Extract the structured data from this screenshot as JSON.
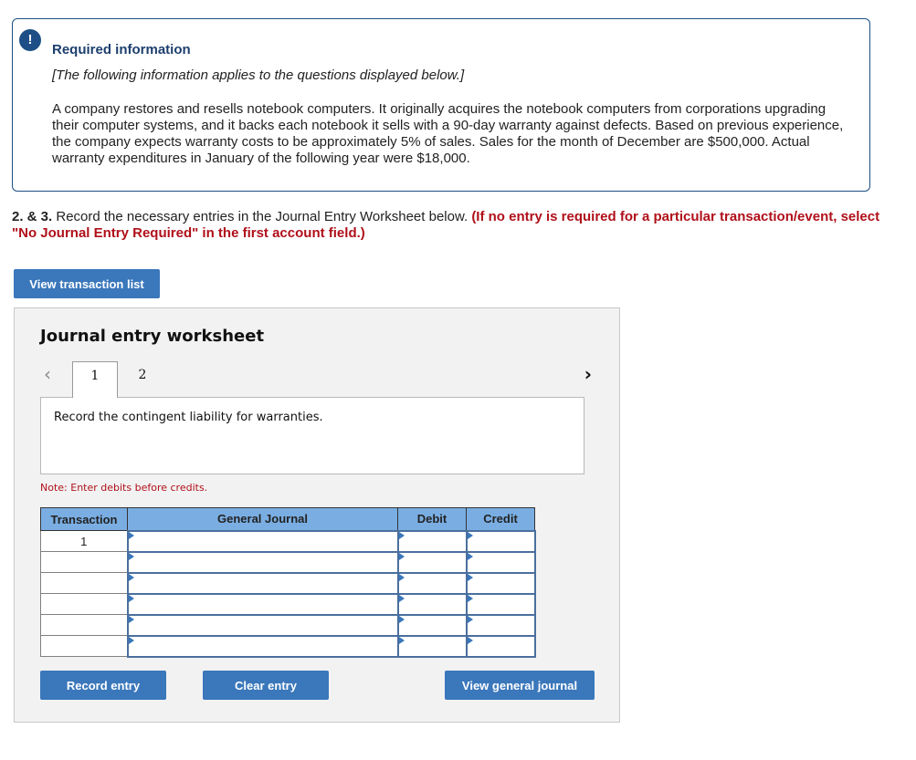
{
  "info": {
    "badge": "!",
    "title": "Required information",
    "subtitle": "[The following information applies to the questions displayed below.]",
    "body": "A company restores and resells notebook computers. It originally acquires the notebook computers from corporations upgrading their computer systems, and it backs each notebook it sells with a 90-day warranty against defects. Based on previous experience, the company expects warranty costs to be approximately 5% of sales. Sales for the month of December are $500,000. Actual warranty expenditures in January of the following year were $18,000."
  },
  "question": {
    "number": "2. & 3.",
    "text": " Record the necessary entries in the Journal Entry Worksheet below. ",
    "instruction": "(If no entry is required for a particular transaction/event, select \"No Journal Entry Required\" in the first account field.)"
  },
  "buttons": {
    "view_transaction_list": "View transaction list",
    "record_entry": "Record entry",
    "clear_entry": "Clear entry",
    "view_general_journal": "View general journal"
  },
  "worksheet": {
    "title": "Journal entry worksheet",
    "prev_icon": "‹",
    "next_icon": "›",
    "tabs": [
      "1",
      "2"
    ],
    "active_tab": "1",
    "description": "Record the contingent liability for warranties.",
    "note": "Note: Enter debits before credits.",
    "table": {
      "headers": [
        "Transaction",
        "General Journal",
        "Debit",
        "Credit"
      ],
      "rows": [
        {
          "transaction": "1",
          "account": "",
          "debit": "",
          "credit": ""
        },
        {
          "transaction": "",
          "account": "",
          "debit": "",
          "credit": ""
        },
        {
          "transaction": "",
          "account": "",
          "debit": "",
          "credit": ""
        },
        {
          "transaction": "",
          "account": "",
          "debit": "",
          "credit": ""
        },
        {
          "transaction": "",
          "account": "",
          "debit": "",
          "credit": ""
        },
        {
          "transaction": "",
          "account": "",
          "debit": "",
          "credit": ""
        }
      ]
    }
  },
  "colors": {
    "accent_blue": "#3a77bb",
    "header_blue": "#7aaee3",
    "info_border": "#1d4f86",
    "required_red": "#b0101a"
  }
}
